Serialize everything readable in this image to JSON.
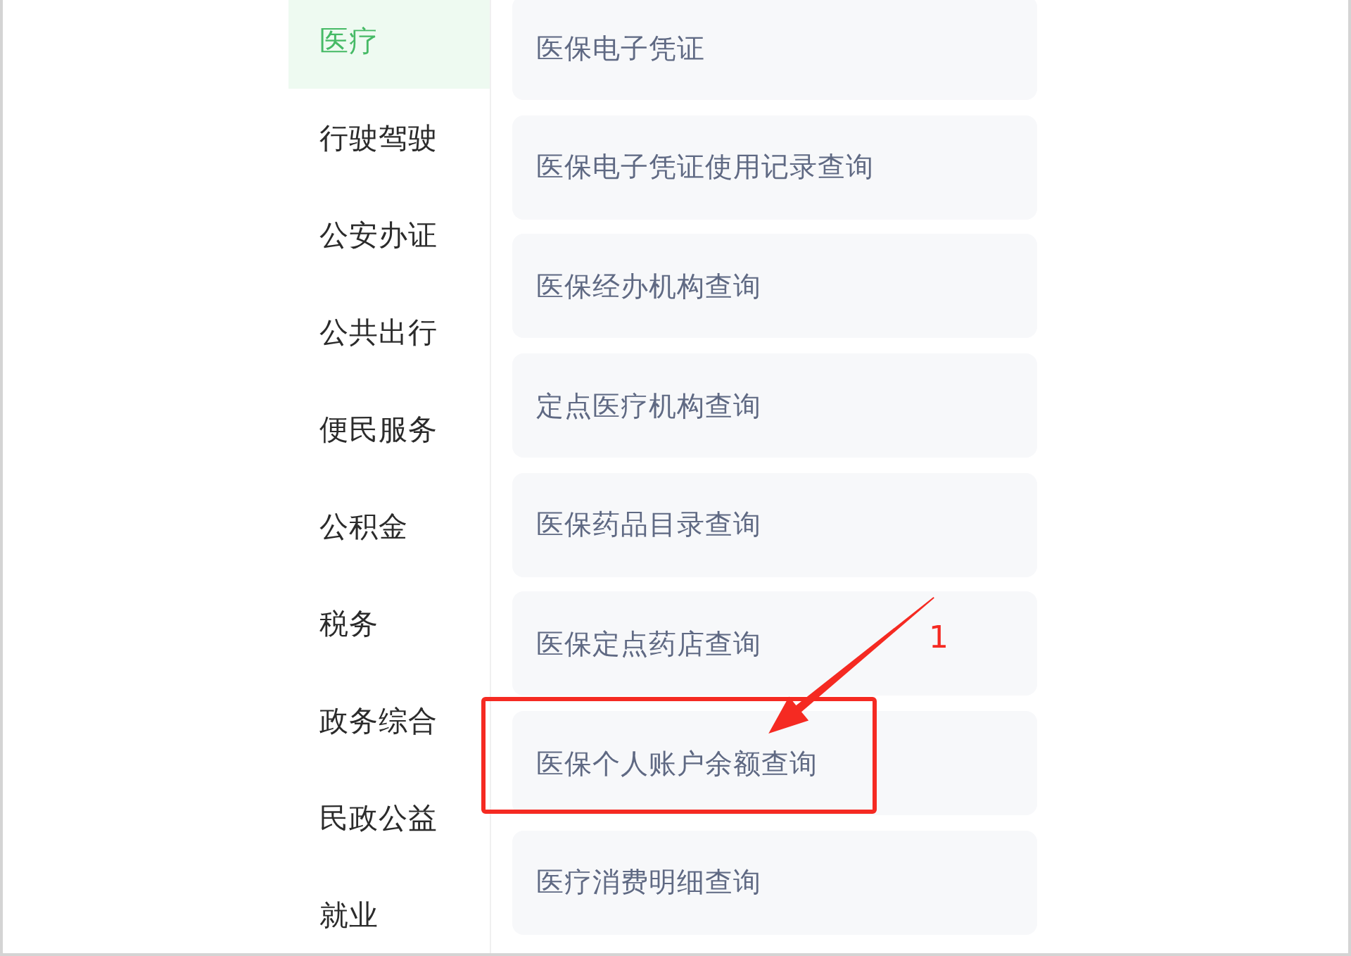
{
  "sidebar": {
    "items": [
      {
        "label": "医疗",
        "selected": true
      },
      {
        "label": "行驶驾驶",
        "selected": false
      },
      {
        "label": "公安办证",
        "selected": false
      },
      {
        "label": "公共出行",
        "selected": false
      },
      {
        "label": "便民服务",
        "selected": false
      },
      {
        "label": "公积金",
        "selected": false
      },
      {
        "label": "税务",
        "selected": false
      },
      {
        "label": "政务综合",
        "selected": false
      },
      {
        "label": "民政公益",
        "selected": false
      },
      {
        "label": "就业",
        "selected": false
      }
    ]
  },
  "services": {
    "items": [
      {
        "label": "医保电子凭证",
        "highlighted": false
      },
      {
        "label": "医保电子凭证使用记录查询",
        "highlighted": false
      },
      {
        "label": "医保经办机构查询",
        "highlighted": false
      },
      {
        "label": "定点医疗机构查询",
        "highlighted": false
      },
      {
        "label": "医保药品目录查询",
        "highlighted": false
      },
      {
        "label": "医保定点药店查询",
        "highlighted": false
      },
      {
        "label": "医保个人账户余额查询",
        "highlighted": true
      },
      {
        "label": "医疗消费明细查询",
        "highlighted": false
      }
    ]
  },
  "annotation": {
    "label": "1"
  }
}
